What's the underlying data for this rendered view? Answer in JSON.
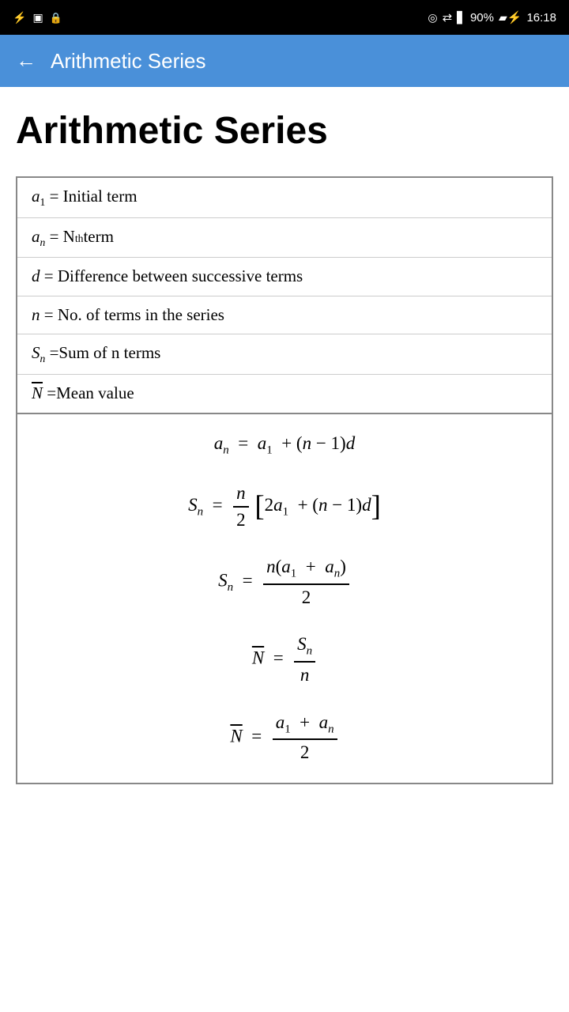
{
  "statusBar": {
    "icons_left": [
      "usb",
      "photo",
      "lock"
    ],
    "icons_right": [
      "alarm",
      "sync",
      "signal",
      "battery_percent",
      "battery",
      "time"
    ],
    "battery_percent": "90%",
    "time": "16:18"
  },
  "appBar": {
    "back_label": "←",
    "title": "Arithmetic Series"
  },
  "page": {
    "heading": "Arithmetic Series"
  },
  "definitions": [
    {
      "symbol": "a₁",
      "description": "= Initial term"
    },
    {
      "symbol": "aₙ",
      "description": "= Nth term"
    },
    {
      "symbol": "d",
      "description": "= Difference between successive terms"
    },
    {
      "symbol": "n",
      "description": "= No. of terms in the series"
    },
    {
      "symbol": "Sₙ",
      "description": "= Sum of n terms"
    },
    {
      "symbol": "N̄",
      "description": "= Mean value"
    }
  ],
  "formulas": [
    "aₙ = a₁ + (n − 1)d",
    "Sₙ = n/2 [2a₁ + (n−1)d]",
    "Sₙ = n(a₁ + aₙ) / 2",
    "N̄ = Sₙ / n",
    "N̄ = (a₁ + aₙ) / 2"
  ]
}
